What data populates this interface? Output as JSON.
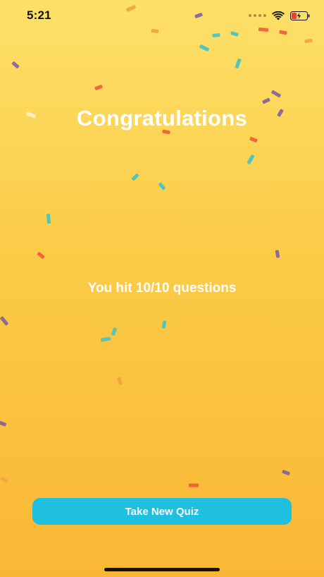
{
  "status_bar": {
    "time": "5:21",
    "signal_icon": "cellular-signal-icon",
    "wifi_icon": "wifi-icon",
    "battery_icon": "battery-charging-icon",
    "battery_color": "#e8422e"
  },
  "main": {
    "title": "Congratulations",
    "score": "You hit 10/10 questions"
  },
  "actions": {
    "take_new_quiz_label": "Take New Quiz"
  },
  "colors": {
    "background_top": "#fde068",
    "background_bottom": "#f9b735",
    "button": "#1ebfdf",
    "confetti": [
      "#f2a23f",
      "#7f5fa3",
      "#3fc3c7",
      "#ee5a3c",
      "#ffffff"
    ]
  }
}
